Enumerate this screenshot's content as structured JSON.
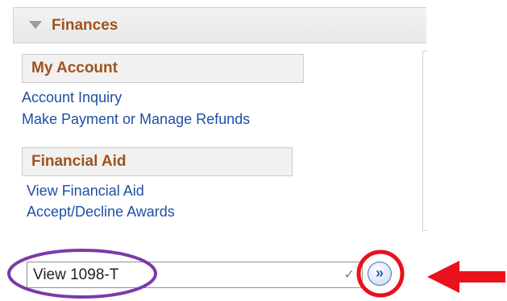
{
  "section": {
    "title": "Finances"
  },
  "groups": [
    {
      "title": "My Account",
      "links": [
        "Account Inquiry",
        "Make Payment or Manage Refunds"
      ]
    },
    {
      "title": "Financial Aid",
      "links": [
        "View Financial Aid",
        "Accept/Decline Awards"
      ]
    }
  ],
  "other_finances": {
    "selected": "View 1098-T",
    "chevron": "✓",
    "go_label": "»"
  },
  "annotations": {
    "ellipse_color": "#7b3aa8",
    "circle_color": "#e8111c",
    "arrow_color": "#e8111c"
  }
}
